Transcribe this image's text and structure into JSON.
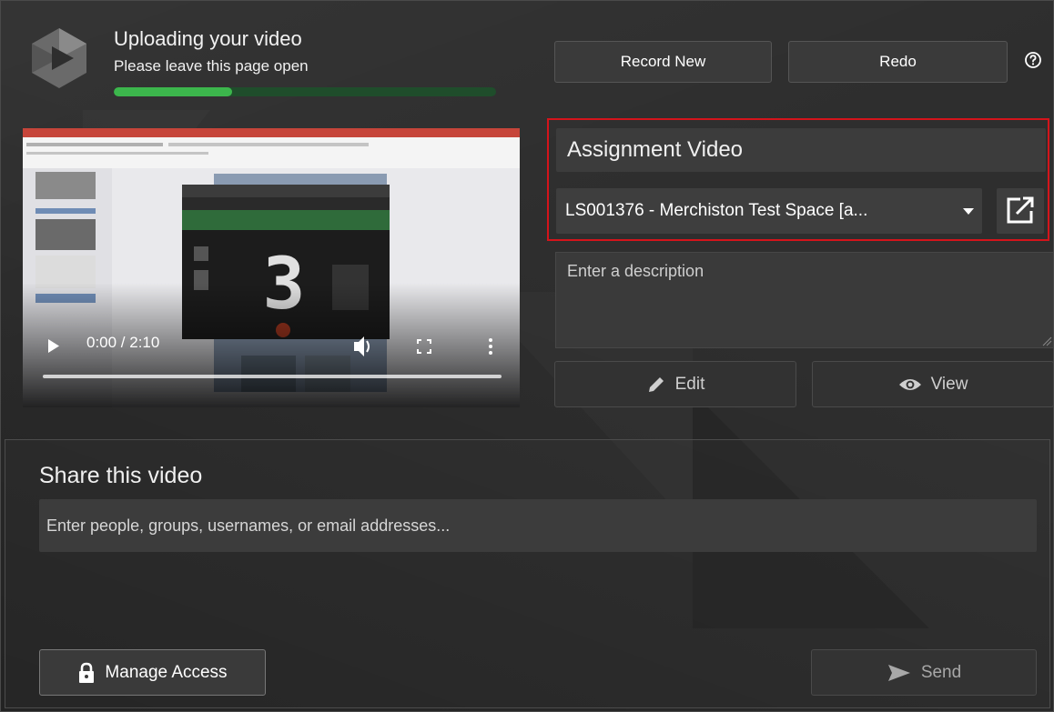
{
  "upload": {
    "title": "Uploading your video",
    "subtitle": "Please leave this page open",
    "progress_fraction": 0.31
  },
  "toolbar": {
    "record_new_label": "Record New",
    "redo_label": "Redo",
    "help_icon": "help-circle-icon"
  },
  "player": {
    "time_display": "0:00 / 2:10",
    "countdown_digit": "3"
  },
  "assignment": {
    "title": "Assignment Video",
    "selected_option": "LS001376 - Merchiston Test Space [a...",
    "dropdown_icon": "caret-down-icon",
    "open_external_icon": "open-external-icon"
  },
  "description": {
    "placeholder": "Enter a description",
    "value": ""
  },
  "actions": {
    "edit_label": "Edit",
    "view_label": "View"
  },
  "share": {
    "title": "Share this video",
    "input_placeholder": "Enter people, groups, usernames, or email addresses...",
    "manage_access_label": "Manage Access",
    "send_label": "Send"
  },
  "colors": {
    "highlight_border": "#d4141b",
    "progress_fill": "#3cb64c",
    "progress_track": "#1f4d2b",
    "background": "#2e2e2e"
  }
}
